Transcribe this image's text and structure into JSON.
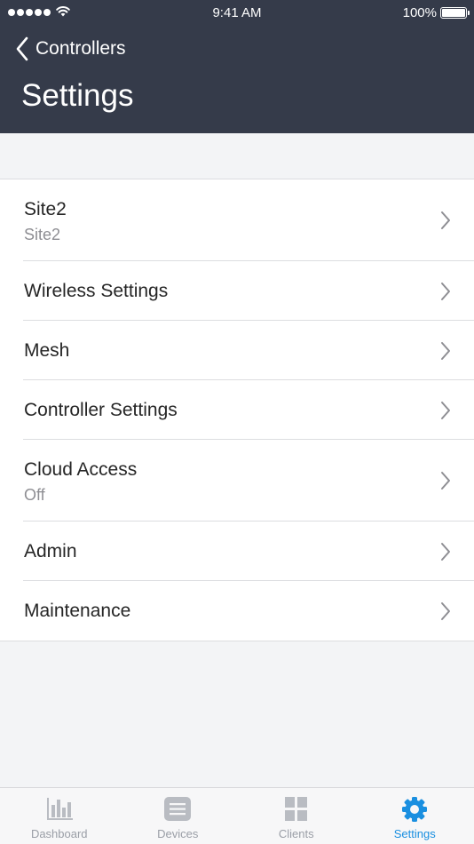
{
  "status_bar": {
    "time": "9:41 AM",
    "battery": "100%",
    "signal_icon": "signal-dots-icon",
    "wifi_icon": "wifi-icon",
    "battery_icon": "battery-icon"
  },
  "nav": {
    "back_label": "Controllers",
    "back_icon": "chevron-left-icon",
    "title": "Settings",
    "background": "#353b4a"
  },
  "settings": {
    "items": [
      {
        "label": "Site2",
        "subtitle": "Site2"
      },
      {
        "label": "Wireless Settings"
      },
      {
        "label": "Mesh"
      },
      {
        "label": "Controller Settings"
      },
      {
        "label": "Cloud Access",
        "subtitle": "Off"
      },
      {
        "label": "Admin"
      },
      {
        "label": "Maintenance"
      }
    ],
    "chevron_icon": "chevron-right-icon"
  },
  "tabbar": {
    "active_color": "#1a8fe0",
    "inactive_color": "#9a9ea6",
    "tabs": [
      {
        "label": "Dashboard",
        "icon": "bar-chart-icon",
        "active": false
      },
      {
        "label": "Devices",
        "icon": "devices-icon",
        "active": false
      },
      {
        "label": "Clients",
        "icon": "grid-icon",
        "active": false
      },
      {
        "label": "Settings",
        "icon": "gear-icon",
        "active": true
      }
    ]
  }
}
